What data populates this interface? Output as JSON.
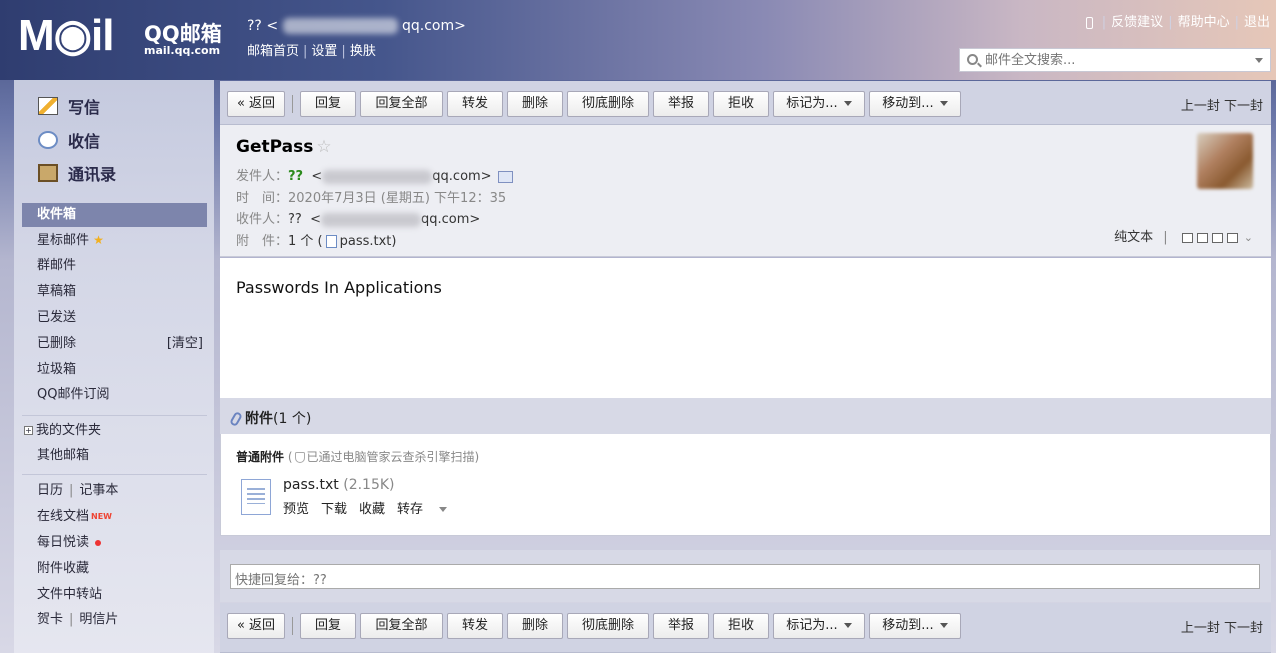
{
  "header": {
    "logo_text": "M◉il",
    "brand": "QQ邮箱",
    "brand_url": "mail.qq.com",
    "account_name": "??",
    "account_lt": "<",
    "account_domain": "qq.com>",
    "nav": [
      "邮箱首页",
      "设置",
      "换肤"
    ],
    "links": [
      "反馈建议",
      "帮助中心",
      "退出"
    ],
    "search_placeholder": "邮件全文搜索..."
  },
  "sidebar": {
    "write": "写信",
    "receive": "收信",
    "contacts": "通讯录",
    "folders": [
      "收件箱",
      "星标邮件",
      "群邮件",
      "草稿箱",
      "已发送",
      "已删除",
      "垃圾箱",
      "QQ邮件订阅"
    ],
    "clear_label": "[清空]",
    "my_folders": "我的文件夹",
    "other_mailbox": "其他邮箱",
    "calendar": "日历",
    "notes": "记事本",
    "online_docs": "在线文档",
    "new_badge": "NEW",
    "daily_read": "每日悦读",
    "attach_fav": "附件收藏",
    "file_transfer": "文件中转站",
    "greeting_card": "贺卡",
    "postcard": "明信片"
  },
  "toolbar": {
    "back": "« 返回",
    "reply": "回复",
    "reply_all": "回复全部",
    "forward": "转发",
    "delete": "删除",
    "perm_delete": "彻底删除",
    "report": "举报",
    "reject": "拒收",
    "mark_as": "标记为...",
    "move_to": "移动到...",
    "prev": "上一封",
    "next": "下一封"
  },
  "mail": {
    "subject": "GetPass",
    "from_label": "发件人：",
    "from_name": "??",
    "from_lt": "<",
    "from_domain": "qq.com>",
    "time_label": "时　间：",
    "time_value": "2020年7月3日 (星期五) 下午12：35",
    "to_label": "收件人：",
    "to_name": "??",
    "to_lt": "<",
    "to_domain": "qq.com>",
    "attach_label": "附　件：",
    "attach_count": "1 个 (",
    "attach_file": "pass.txt",
    "attach_close": ")",
    "plain_text": "纯文本",
    "body": "Passwords In Applications"
  },
  "attachments": {
    "title": "附件",
    "count": "(1 个)",
    "kind": "普通附件",
    "scan_note": "已通过电脑管家云查杀引擎扫描)",
    "scan_open": "(",
    "file_name": "pass.txt",
    "file_size": "(2.15K)",
    "actions": [
      "预览",
      "下载",
      "收藏",
      "转存"
    ]
  },
  "quick_reply": {
    "placeholder": "快捷回复给：??"
  }
}
